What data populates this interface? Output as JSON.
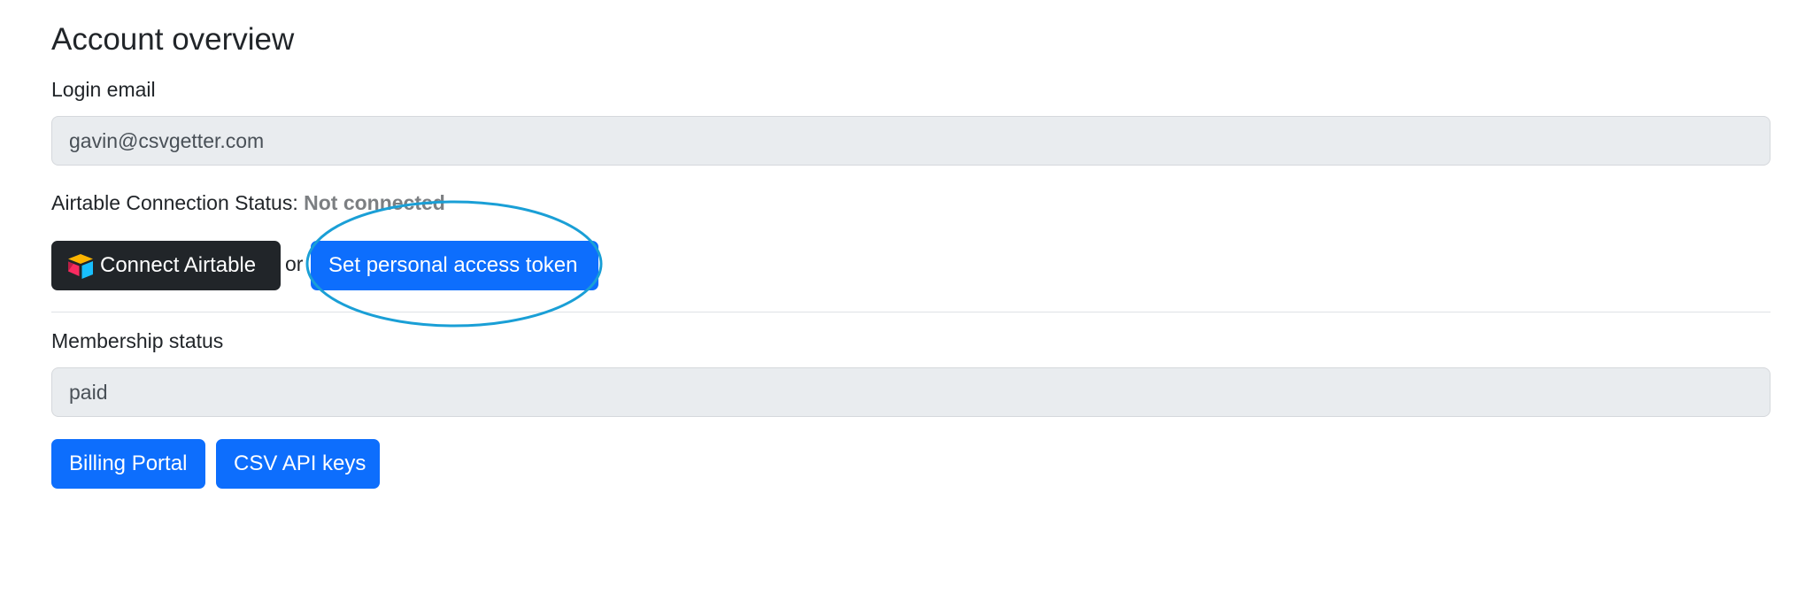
{
  "page": {
    "title": "Account overview"
  },
  "login_email": {
    "label": "Login email",
    "value": "gavin@csvgetter.com"
  },
  "airtable": {
    "status_label": "Airtable Connection Status:",
    "status_value": "Not connected",
    "connect_button": "Connect Airtable",
    "or_text": "or",
    "token_button": "Set personal access token"
  },
  "membership": {
    "label": "Membership status",
    "value": "paid"
  },
  "actions": {
    "billing_button": "Billing Portal",
    "api_keys_button": "CSV API keys"
  },
  "colors": {
    "primary": "#0d6efd",
    "dark_button": "#212529",
    "annotation_ellipse": "#1a9fd6",
    "input_background": "#e9ecef",
    "status_muted": "#7c7f82"
  },
  "icons": {
    "connect_button_icon": "airtable-logo-icon"
  }
}
